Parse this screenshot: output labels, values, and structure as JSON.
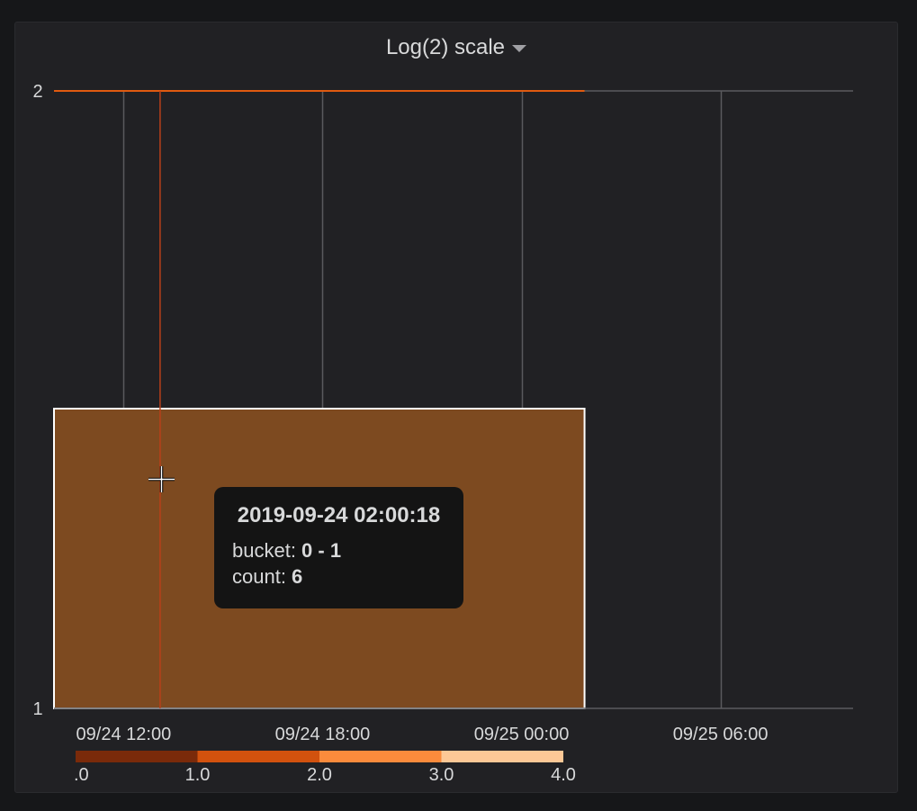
{
  "panel": {
    "title": "Log(2) scale"
  },
  "tooltip": {
    "time": "2019-09-24 02:00:18",
    "bucket_label": "bucket: ",
    "bucket_value": "0 - 1",
    "count_label": "count: ",
    "count_value": "6"
  },
  "colors": {
    "background": "#161719",
    "panel": "#212124",
    "grid": "#5a5a5e",
    "cell": "#7d4a20",
    "cell_border": "#ffffff",
    "top_line": "#e05a10",
    "cursor_line": "#b8401a"
  },
  "chart_data": {
    "type": "heatmap",
    "title": "Log(2) scale",
    "x_tick_labels": [
      "09/24 12:00",
      "09/24 18:00",
      "09/25 00:00",
      "09/25 06:00"
    ],
    "x_ticks_hours": [
      12,
      18,
      24,
      30
    ],
    "x_range_hours": [
      9.9,
      34
    ],
    "y_tick_labels": [
      "1",
      "2"
    ],
    "y_ticks": [
      1,
      2
    ],
    "y_range": [
      1,
      2
    ],
    "y_scale": "log2",
    "cells": [
      {
        "x_start_hours": 9.9,
        "x_end_hours": 25.9,
        "y_low": 1,
        "y_high": 1.4,
        "count": 6
      }
    ],
    "legend": {
      "tick_labels": [
        ".0",
        "1.0",
        "2.0",
        "3.0",
        "4.0"
      ],
      "min": 0,
      "max": 4,
      "colors": [
        "#7a2a0a",
        "#d2520e",
        "#fb8b3c",
        "#fdc896"
      ]
    },
    "cursor_hours": 13.1
  }
}
